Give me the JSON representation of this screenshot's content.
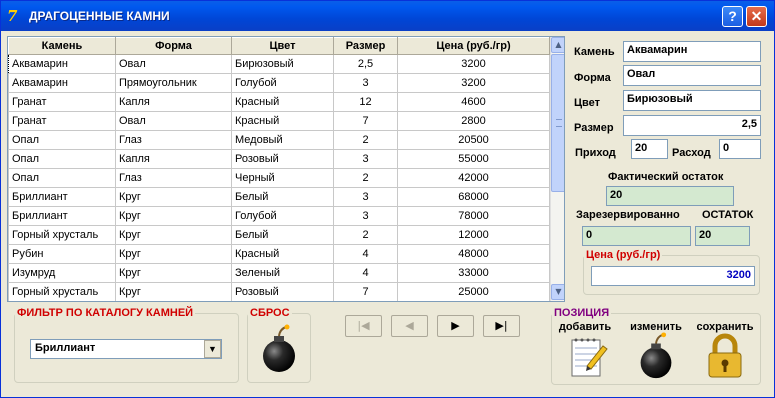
{
  "window": {
    "title": "ДРАГОЦЕННЫЕ КАМНИ",
    "icon": "delphi-icon",
    "help_label": "?",
    "close_label": "✕"
  },
  "table": {
    "columns": [
      "Камень",
      "Форма",
      "Цвет",
      "Размер",
      "Цена (руб./гр)"
    ],
    "rows": [
      [
        "Аквамарин",
        "Овал",
        "Бирюзовый",
        "2,5",
        "3200"
      ],
      [
        "Аквамарин",
        "Прямоугольник",
        "Голубой",
        "3",
        "3200"
      ],
      [
        "Гранат",
        "Капля",
        "Красный",
        "12",
        "4600"
      ],
      [
        "Гранат",
        "Овал",
        "Красный",
        "7",
        "2800"
      ],
      [
        "Опал",
        "Глаз",
        "Медовый",
        "2",
        "20500"
      ],
      [
        "Опал",
        "Капля",
        "Розовый",
        "3",
        "55000"
      ],
      [
        "Опал",
        "Глаз",
        "Черный",
        "2",
        "42000"
      ],
      [
        "Бриллиант",
        "Круг",
        "Белый",
        "3",
        "68000"
      ],
      [
        "Бриллиант",
        "Круг",
        "Голубой",
        "3",
        "78000"
      ],
      [
        "Горный хрусталь",
        "Круг",
        "Белый",
        "2",
        "12000"
      ],
      [
        "Рубин",
        "Круг",
        "Красный",
        "4",
        "48000"
      ],
      [
        "Изумруд",
        "Круг",
        "Зеленый",
        "4",
        "33000"
      ],
      [
        "Горный хрусталь",
        "Круг",
        "Розовый",
        "7",
        "25000"
      ]
    ],
    "scroll_up": "▲",
    "scroll_down": "▼"
  },
  "details": {
    "stone_label": "Камень",
    "stone_value": "Аквамарин",
    "shape_label": "Форма",
    "shape_value": "Овал",
    "color_label": "Цвет",
    "color_value": "Бирюзовый",
    "size_label": "Размер",
    "size_value": "2,5",
    "income_label": "Приход",
    "income_value": "20",
    "expense_label": "Расход",
    "expense_value": "0",
    "actual_label": "Фактический остаток",
    "actual_value": "20",
    "reserved_label": "Зарезервированно",
    "reserved_value": "0",
    "remaining_label": "ОСТАТОК",
    "remaining_value": "20",
    "price_label": "Цена (руб./гр)",
    "price_value": "3200"
  },
  "filter": {
    "label": "ФИЛЬТР ПО КАТАЛОГУ КАМНЕЙ",
    "selected": "Бриллиант",
    "arrow": "▼"
  },
  "reset": {
    "label": "СБРОС",
    "icon": "bomb-icon"
  },
  "navigator": {
    "first": "|◀",
    "prior": "◀",
    "next": "▶",
    "last": "▶|"
  },
  "position": {
    "label": "ПОЗИЦИЯ",
    "add_label": "добавить",
    "add_icon": "notepad-pencil-icon",
    "edit_label": "изменить",
    "edit_icon": "bomb-icon",
    "save_label": "сохранить",
    "save_icon": "padlock-icon"
  },
  "colors": {
    "title_bar": "#0054e3",
    "window_bg": "#ece9d8",
    "filter_legend": "#d00000",
    "price_legend": "#d00000",
    "price_value": "#0000c0",
    "position_legend": "#800080",
    "status_field": "#d4e9d0"
  }
}
